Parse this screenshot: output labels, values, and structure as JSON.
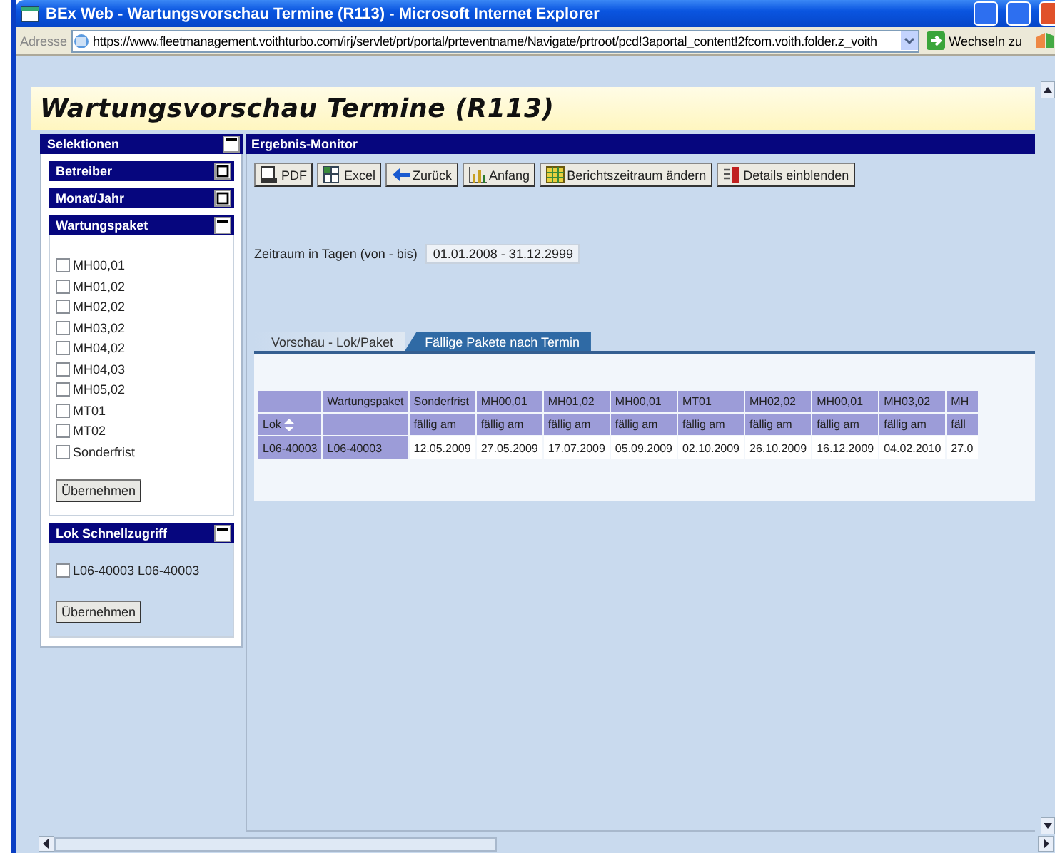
{
  "window": {
    "title": "BEx Web - Wartungsvorschau Termine (R113) - Microsoft Internet Explorer"
  },
  "address_bar": {
    "label": "Adresse",
    "url": "https://www.fleetmanagement.voithturbo.com/irj/servlet/prt/portal/prteventname/Navigate/prtroot/pcd!3aportal_content!2fcom.voith.folder.z_voith",
    "go_button": "Wechseln zu"
  },
  "page_title": "Wartungsvorschau Termine (R113)",
  "sidebar": {
    "title": "Selektionen",
    "expanded": true,
    "sections": [
      {
        "title": "Betreiber",
        "expanded": false
      },
      {
        "title": "Monat/Jahr",
        "expanded": false
      },
      {
        "title": "Wartungspaket",
        "expanded": true,
        "options": [
          {
            "label": "MH00,01",
            "checked": false
          },
          {
            "label": "MH01,02",
            "checked": false
          },
          {
            "label": "MH02,02",
            "checked": false
          },
          {
            "label": "MH03,02",
            "checked": false
          },
          {
            "label": "MH04,02",
            "checked": false
          },
          {
            "label": "MH04,03",
            "checked": false
          },
          {
            "label": "MH05,02",
            "checked": false
          },
          {
            "label": "MT01",
            "checked": false
          },
          {
            "label": "MT02",
            "checked": false
          },
          {
            "label": "Sonderfrist",
            "checked": false
          }
        ],
        "button": "Übernehmen"
      },
      {
        "title": "Lok Schnellzugriff",
        "expanded": true,
        "options": [
          {
            "label": "L06-40003 L06-40003",
            "checked": false
          }
        ],
        "button": "Übernehmen"
      }
    ]
  },
  "monitor": {
    "title": "Ergebnis-Monitor",
    "toolbar": [
      "PDF",
      "Excel",
      "Zurück",
      "Anfang",
      "Berichtszeitraum ändern",
      "Details einblenden"
    ],
    "period": {
      "label": "Zeitraum in Tagen (von - bis)",
      "value": "01.01.2008 - 31.12.2999"
    },
    "tabs": [
      {
        "label": "Vorschau - Lok/Paket",
        "selected": false
      },
      {
        "label": "Fällige Pakete nach Termin",
        "selected": true
      }
    ],
    "table": {
      "columns": [
        {
          "subheading": "Lok",
          "sortable": true
        },
        {
          "heading": "Wartungspaket"
        },
        {
          "heading": "Sonderfrist",
          "subheading": "fällig am"
        },
        {
          "heading": "MH00,01",
          "subheading": "fällig am"
        },
        {
          "heading": "MH01,02",
          "subheading": "fällig am"
        },
        {
          "heading": "MH00,01",
          "subheading": "fällig am"
        },
        {
          "heading": "MT01",
          "subheading": "fällig am"
        },
        {
          "heading": "MH02,02",
          "subheading": "fällig am"
        },
        {
          "heading": "MH00,01",
          "subheading": "fällig am"
        },
        {
          "heading": "MH03,02",
          "subheading": "fällig am"
        },
        {
          "heading": "MH",
          "subheading": "fäll"
        }
      ],
      "rows": [
        [
          "L06-40003",
          "L06-40003",
          "12.05.2009",
          "27.05.2009",
          "17.07.2009",
          "05.09.2009",
          "02.10.2009",
          "26.10.2009",
          "16.12.2009",
          "04.02.2010",
          "27.0"
        ]
      ]
    }
  }
}
